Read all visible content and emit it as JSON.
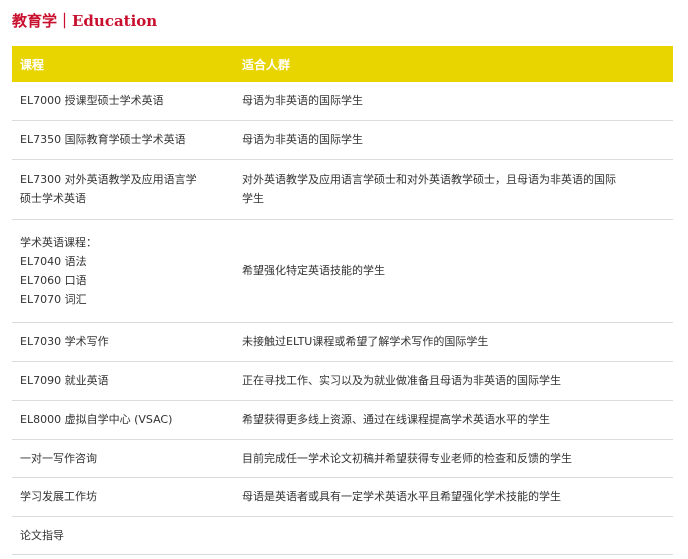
{
  "title": "教育学｜Education",
  "colors": {
    "title": "#c8102e",
    "header_bg": "#e8d500",
    "header_text": "#ffffff",
    "row_border": "#dcdcdc",
    "body_text": "#333333"
  },
  "table": {
    "headers": [
      "课程",
      "适合人群"
    ],
    "rows": [
      {
        "course": [
          "EL7000 授课型硕士学术英语"
        ],
        "audience": [
          "母语为非英语的国际学生"
        ]
      },
      {
        "course": [
          "EL7350 国际教育学硕士学术英语"
        ],
        "audience": [
          "母语为非英语的国际学生"
        ]
      },
      {
        "course": [
          "EL7300 对外英语教学及应用语言学",
          "硕士学术英语"
        ],
        "audience": [
          "对外英语教学及应用语言学硕士和对外英语教学硕士，且母语为非英语的国际",
          "学生"
        ]
      },
      {
        "course": [
          "学术英语课程：",
          "EL7040 语法",
          "EL7060 口语",
          "EL7070 词汇"
        ],
        "audience": [
          "希望强化特定英语技能的学生"
        ]
      },
      {
        "course": [
          "EL7030 学术写作"
        ],
        "audience": [
          "未接触过ELTU课程或希望了解学术写作的国际学生"
        ]
      },
      {
        "course": [
          "EL7090 就业英语"
        ],
        "audience": [
          "正在寻找工作、实习以及为就业做准备且母语为非英语的国际学生"
        ]
      },
      {
        "course": [
          "EL8000 虚拟自学中心 (VSAC)"
        ],
        "audience": [
          "希望获得更多线上资源、通过在线课程提高学术英语水平的学生"
        ]
      },
      {
        "course": [
          "一对一写作咨询"
        ],
        "audience": [
          "目前完成任一学术论文初稿并希望获得专业老师的检查和反馈的学生"
        ]
      },
      {
        "course": [
          "学习发展工作坊"
        ],
        "audience": [
          "母语是英语者或具有一定学术英语水平且希望强化学术技能的学生"
        ]
      },
      {
        "course": [
          "论文指导"
        ],
        "audience": []
      }
    ]
  }
}
